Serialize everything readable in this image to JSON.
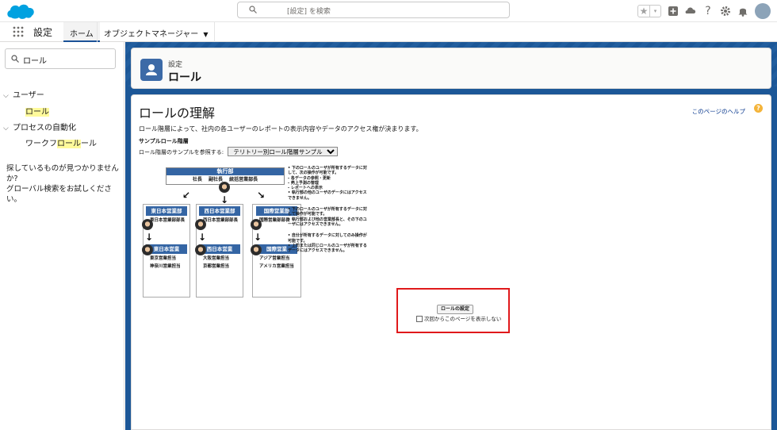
{
  "search": {
    "placeholder": "[設定] を検索"
  },
  "nav": {
    "app_name": "設定",
    "tabs": [
      {
        "label": "ホーム"
      },
      {
        "label": "オブジェクトマネージャー"
      }
    ]
  },
  "sidebar": {
    "quickfind_value": "ロール",
    "tree": [
      {
        "label": "ユーザー"
      },
      {
        "label_pre": "",
        "label_hl": "ロール",
        "label_post": ""
      },
      {
        "label": "プロセスの自動化"
      },
      {
        "label_pre": "ワークフ",
        "label_hl": "ロール",
        "label_post": "ール"
      }
    ],
    "no_result_line1": "探しているものが見つかりませんか?",
    "no_result_line2": "グローバル検索をお試しください。"
  },
  "header": {
    "breadcrumb": "設定",
    "title": "ロール"
  },
  "content": {
    "heading": "ロールの理解",
    "help_link": "このページのヘルプ",
    "description": "ロール階層によって、社内の各ユーザーのレポートの表示内容やデータのアクセス権が決まります。",
    "sample_heading": "サンプルロール階層",
    "sample_select_label": "ロール階層のサンプルを参照する:",
    "sample_select_value": "テリトリー別ロール階層サンプル",
    "org": {
      "exec_title": "執行部",
      "exec_members": "社長 副社長 統括営業部長",
      "depts": [
        {
          "title": "東日本営業部",
          "member": "東日本営業部部長",
          "sub_title": "東日本営業",
          "sub_members": [
            "東京営業担当",
            "神奈川営業担当"
          ]
        },
        {
          "title": "西日本営業部",
          "member": "西日本営業部部長",
          "sub_title": "西日本営業",
          "sub_members": [
            "大阪営業担当",
            "京都営業担当"
          ]
        },
        {
          "title": "国際営業部",
          "member": "国際営業部部長",
          "sub_title": "国際営業",
          "sub_members": [
            "アジア営業担当",
            "アメリカ営業担当"
          ]
        }
      ],
      "notes": [
        "• 下のロールのユーザが所有するデータに対して、次の操作が可能です。",
        "  - 各データの参照・更新",
        "  - 売上予測の管理",
        "  - レポートへの表示",
        "• 執行部の他のユーザのデータにはアクセスできません。",
        "• 下のロールのユーザが所有するデータに対して操作が可能です。",
        "• 執行部および他の営業部長と、その下のユーザにはアクセスできません。",
        "• 自分が所有するデータに対してのみ操作が可能です。",
        "• 上司または同じロールのユーザが所有するデータにはアクセスできません。"
      ]
    },
    "role_button": "ロールの設定",
    "dont_show_label": "次回からこのページを表示しない"
  },
  "colors": {
    "brand": "#00a1e0",
    "band": "#1c5797",
    "highlight_frame": "#e0191b",
    "org_header": "#3465a4"
  }
}
